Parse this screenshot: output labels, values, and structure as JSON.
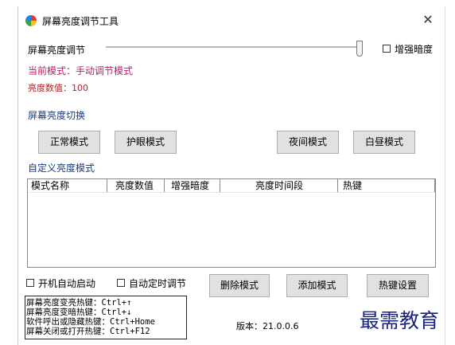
{
  "window": {
    "title": "屏幕亮度调节工具",
    "close_glyph": "✕"
  },
  "brightness": {
    "label": "屏幕亮度调节",
    "enhance_dim_label": "增强暗度",
    "slider_level_percent": 100,
    "mode_text": "当前模式：手动调节模式",
    "value_text": "亮度数值：100"
  },
  "switch_section": {
    "label": "屏幕亮度切换",
    "buttons": [
      "正常模式",
      "护眼模式",
      "夜间模式",
      "白昼模式"
    ]
  },
  "custom_section": {
    "label": "自定义亮度模式",
    "columns": [
      "模式名称",
      "亮度数值",
      "增强暗度",
      "亮度时间段",
      "热键"
    ]
  },
  "options": {
    "autostart_label": "开机自动启动",
    "auto_timed_label": "自动定时调节"
  },
  "actions": {
    "delete": "删除模式",
    "add": "添加模式",
    "hotkey_settings": "热键设置"
  },
  "hotkeys": [
    "屏幕亮度变亮热键：Ctrl+↑",
    "屏幕亮度变暗热键：Ctrl+↓",
    "软件呼出或隐藏热键：Ctrl+Home",
    "屏幕关闭或打开热键：Ctrl+F12"
  ],
  "version": "版本：21.0.0.6",
  "watermark": "最需教育"
}
